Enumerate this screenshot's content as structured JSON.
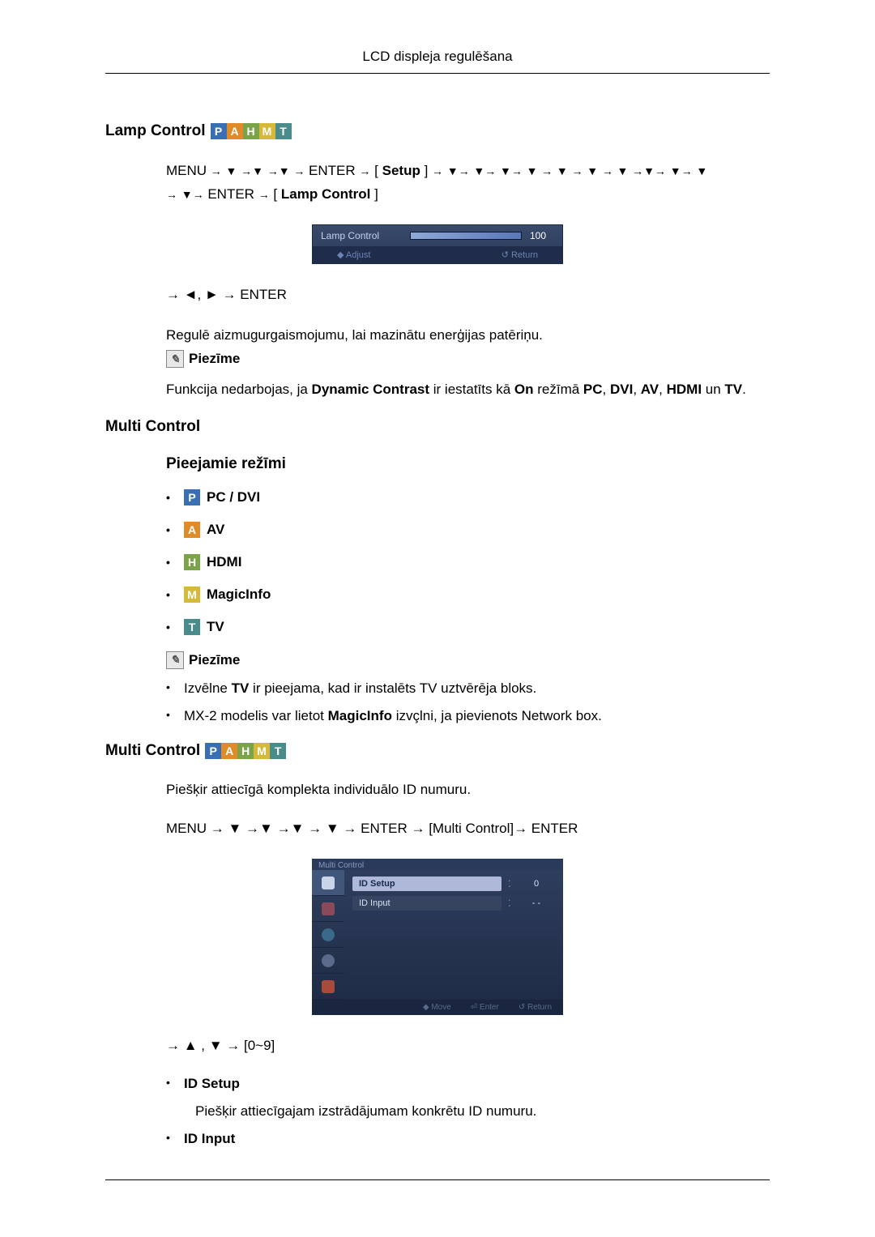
{
  "header": {
    "title": "LCD displeja regulēšana"
  },
  "badges": [
    "P",
    "A",
    "H",
    "M",
    "T"
  ],
  "lamp": {
    "title": "Lamp Control",
    "path_tokens": [
      "MENU",
      "→",
      "▼",
      "→▼",
      "→▼",
      "→",
      "ENTER",
      "→",
      "[",
      "Setup",
      "]",
      "→",
      "▼→",
      "▼→",
      "▼→",
      "▼",
      "→",
      "▼",
      "→",
      "▼",
      "→",
      "▼",
      "→▼→",
      "▼→",
      "▼"
    ],
    "path_tokens2": [
      "→",
      "▼→",
      "ENTER",
      "→",
      "[",
      "Lamp Control",
      "]"
    ],
    "menu_label": "Lamp Control",
    "menu_value": "100",
    "menu_hint_left": "◆ Adjust",
    "menu_hint_right": "↺ Return",
    "nav2": "→ ◄, ► → ENTER",
    "body": "Regulē aizmugurgaismojumu, lai mazinātu enerģijas patēriņu.",
    "note_label": "Piezīme",
    "note_text_parts": [
      "Funkcija nedarbojas, ja ",
      "Dynamic Contrast",
      " ir iestatīts kā ",
      "On",
      " režīmā ",
      "PC",
      ", ",
      "DVI",
      ", ",
      "AV",
      ", ",
      "HDMI",
      " un ",
      "TV",
      "."
    ]
  },
  "multi1": {
    "title": "Multi Control",
    "subtitle": "Pieejamie režīmi",
    "modes": [
      {
        "badge": "P",
        "label": "PC / DVI"
      },
      {
        "badge": "A",
        "label": "AV"
      },
      {
        "badge": "H",
        "label": "HDMI"
      },
      {
        "badge": "M",
        "label": "MagicInfo"
      },
      {
        "badge": "T",
        "label": "TV"
      }
    ],
    "note_label": "Piezīme",
    "notes": [
      {
        "pre": "Izvēlne ",
        "bold": "TV",
        "post": " ir pieejama, kad ir instalēts TV uztvērēja bloks."
      },
      {
        "pre": "MX-2 modelis var lietot ",
        "bold": "MagicInfo",
        "post": " izvçlni, ja pievienots Network box."
      }
    ]
  },
  "multi2": {
    "title": "Multi Control",
    "intro": "Piešķir attiecīgā komplekta individuālo ID numuru.",
    "path": "MENU → ▼ →▼ →▼ → ▼ → ENTER → [Multi Control]→ ENTER",
    "menu_title": "Multi Control",
    "rows": [
      {
        "label": "ID  Setup",
        "val": "0",
        "sel": true
      },
      {
        "label": "ID  Input",
        "val": "- -",
        "sel": false
      }
    ],
    "footer": [
      "◆ Move",
      "⏎ Enter",
      "↺ Return"
    ],
    "nav3": "→ ▲ , ▼ → [0~9]",
    "bullets": [
      {
        "bold": true,
        "text": "ID Setup"
      },
      {
        "bold": false,
        "text": "Piešķir attiecīgajam izstrādājumam konkrētu ID numuru."
      },
      {
        "bold": true,
        "text": "ID Input"
      }
    ]
  }
}
